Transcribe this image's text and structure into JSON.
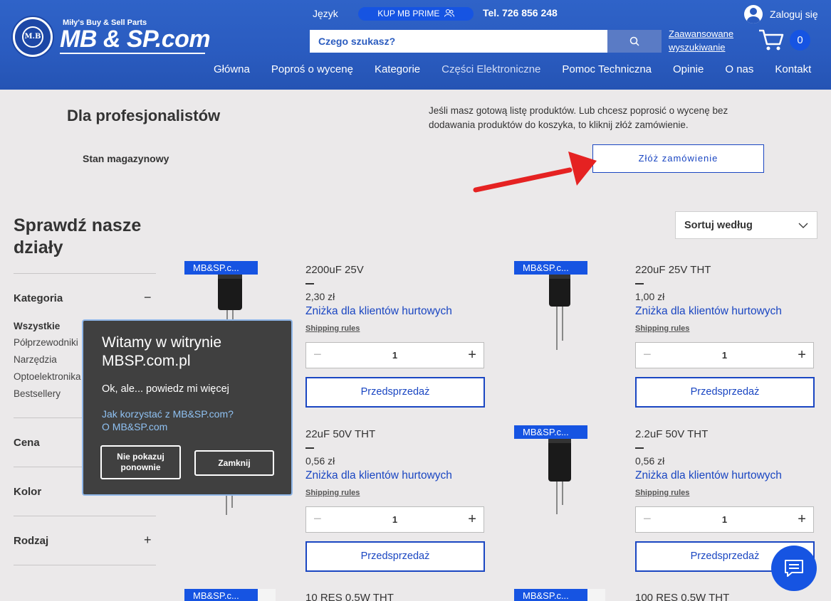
{
  "header": {
    "logo_small": "Miły's Buy & Sell Parts",
    "logo_big": "MB & SP.com",
    "logo_circle": "M.B",
    "language": "Język",
    "prime": "KUP MB PRIME",
    "phone": "Tel. 726 856 248",
    "login": "Zaloguj się",
    "search_placeholder": "Czego szukasz?",
    "advanced_1": "Zaawansowane",
    "advanced_2": "wyszukiwanie",
    "cart_count": "0"
  },
  "nav": [
    "Główna",
    "Poproś o wycenę",
    "Kategorie",
    "Części Elektroniczne",
    "Pomoc Techniczna",
    "Opinie",
    "O nas",
    "Kontakt"
  ],
  "pro": {
    "title": "Dla profesjonalistów",
    "stock": "Stan magazynowy",
    "text": "Jeśli masz gotową listę produktów. Lub chcesz poprosić o wycenę bez dodawania produktów do koszyka, to kliknij złóż zamówienie.",
    "order_button": "Złóż zamówienie"
  },
  "sidebar": {
    "title": "Sprawdź nasze działy",
    "category": "Kategoria",
    "items": [
      "Wszystkie",
      "Półprzewodniki",
      "Narzędzia",
      "Optoelektronika",
      "Bestsellery"
    ],
    "price": "Cena",
    "color": "Kolor",
    "type": "Rodzaj"
  },
  "sort_label": "Sortuj według",
  "products": [
    {
      "badge": "MB&SP.c...",
      "name": "2200uF 25V",
      "price": "2,30 zł",
      "discount": "Zniżka dla klientów hurtowych",
      "shipping": "Shipping rules",
      "qty": "1",
      "button": "Przedsprzedaż"
    },
    {
      "badge": "MB&SP.c...",
      "name": "220uF 25V THT",
      "price": "1,00 zł",
      "discount": "Zniżka dla klientów hurtowych",
      "shipping": "Shipping rules",
      "qty": "1",
      "button": "Przedsprzedaż"
    },
    {
      "badge": "",
      "name": "22uF 50V THT",
      "price": "0,56 zł",
      "discount": "Zniżka dla klientów hurtowych",
      "shipping": "Shipping rules",
      "qty": "1",
      "button": "Przedsprzedaż"
    },
    {
      "badge": "MB&SP.c...",
      "name": "2.2uF 50V THT",
      "price": "0,56 zł",
      "discount": "Zniżka dla klientów hurtowych",
      "shipping": "Shipping rules",
      "qty": "1",
      "button": "Przedsprzedaż"
    },
    {
      "badge": "MB&SP.c...",
      "name": "10 RES 0.5W THT"
    },
    {
      "badge": "MB&SP.c...",
      "name": "100 RES 0.5W THT"
    }
  ],
  "popup": {
    "title": "Witamy w witrynie MBSP.com.pl",
    "subtitle": "Ok, ale... powiedz mi więcej",
    "link1": "Jak korzystać z MB&SP.com?",
    "link2": "O MB&SP.com",
    "dont_show": "Nie pokazuj ponownie",
    "close": "Zamknij"
  },
  "colors": {
    "header": "#2a5bbf",
    "accent": "#1654e2",
    "link": "#1a46c2",
    "arrow": "#e52222"
  }
}
